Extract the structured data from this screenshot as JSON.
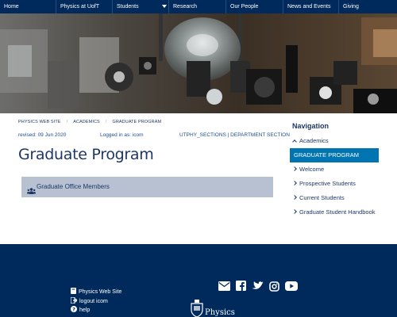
{
  "topnav": {
    "items": [
      {
        "label": "Home"
      },
      {
        "label": "Physics at UofT"
      },
      {
        "label": "Students"
      },
      {
        "label": "Research"
      },
      {
        "label": "Our People"
      },
      {
        "label": "News and Events"
      },
      {
        "label": "Giving"
      }
    ]
  },
  "breadcrumb": {
    "items": [
      {
        "label": "PHYSICS WEB SITE"
      },
      {
        "label": "ACADEMICS"
      },
      {
        "label": "GRADUATE PROGRAM"
      }
    ]
  },
  "meta": {
    "revised": "revised: 09 Jun 2020",
    "logged_in": "Logged in as: icom",
    "sections": "UTPHY_SECTIONS | DEPARTMENT SECTION"
  },
  "page": {
    "title": "Graduate Program",
    "office_link": "Graduate Office Members"
  },
  "sidebar": {
    "heading": "Navigation",
    "items": [
      {
        "label": "Academics"
      },
      {
        "label": "GRADUATE PROGRAM"
      },
      {
        "label": "Welcome"
      },
      {
        "label": "Prospective Students"
      },
      {
        "label": "Current Students"
      },
      {
        "label": "Graduate Student Handbook"
      }
    ]
  },
  "footer": {
    "links": [
      {
        "label": "Physics Web Site"
      },
      {
        "label": "logout icom"
      },
      {
        "label": "help"
      }
    ],
    "logo_text": "Physics",
    "social_icons": [
      "email-icon",
      "facebook-icon",
      "twitter-icon",
      "instagram-icon",
      "youtube-icon"
    ]
  },
  "colors": {
    "navy": "#002a5c",
    "accent_blue": "#0075b2",
    "box_grey": "#b7c1d2",
    "text_navy": "#1e3765"
  }
}
